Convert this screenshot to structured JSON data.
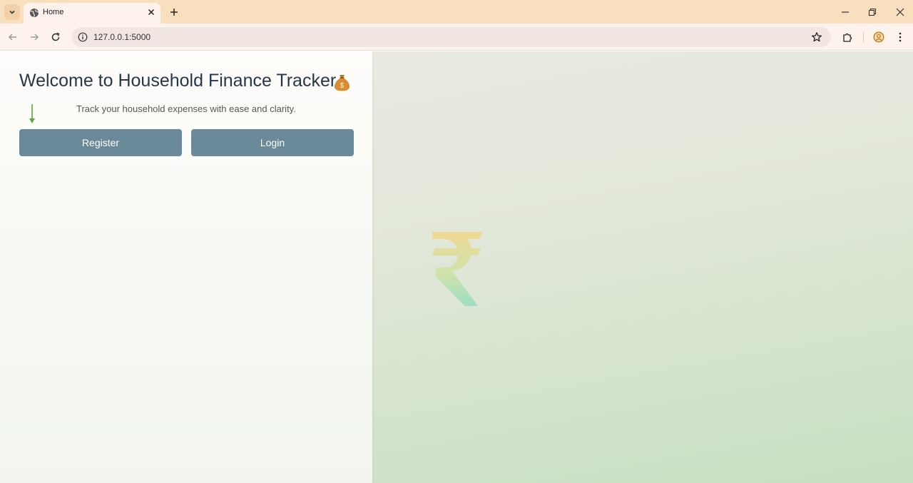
{
  "browser": {
    "tab": {
      "title": "Home"
    },
    "address_bar": {
      "url": "127.0.0.1:5000"
    },
    "icons": {
      "tab_search": "chevron-down-icon",
      "favicon": "globe-icon",
      "tab_close": "close-icon",
      "new_tab": "plus-icon",
      "minimize": "minimize-icon",
      "restore": "restore-icon",
      "close_window": "close-icon",
      "back": "arrow-left-icon",
      "forward": "arrow-right-icon",
      "reload": "reload-icon",
      "site_info": "info-icon",
      "bookmark": "star-icon",
      "extensions": "puzzle-icon",
      "profile": "profile-icon",
      "menu": "kebab-menu-icon"
    }
  },
  "page": {
    "title": "Welcome to Household Finance Tracker",
    "title_emoji": "money-bag-icon",
    "subtitle": "Track your household expenses with ease and clarity.",
    "buttons": {
      "register": "Register",
      "login": "Login"
    },
    "watermark": "rupee-icon"
  },
  "colors": {
    "tabbar": "#f8dfbd",
    "toolbar": "#fdf3ec",
    "title": "#26374a",
    "button": "#6b8a99",
    "arrow": "#5aa83c",
    "background_top": "#edebe4",
    "background_bottom": "#c9e0c1"
  }
}
